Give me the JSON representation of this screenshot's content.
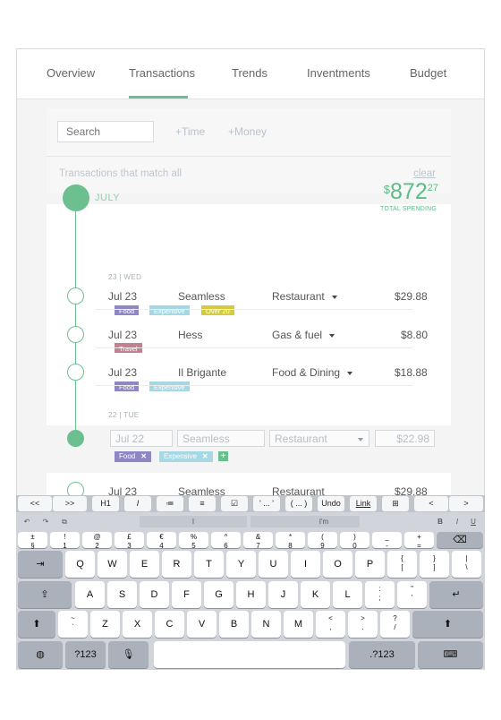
{
  "tabs": [
    "Overview",
    "Transactions",
    "Trends",
    "Inventments",
    "Budget"
  ],
  "filter": {
    "search_placeholder": "Search",
    "time_link": "+Time",
    "money_link": "+Money",
    "match_text": "Transactions that match all",
    "clear_link": "clear"
  },
  "month": {
    "label": "JULY",
    "total_currency": "$",
    "total_int": "872",
    "total_dec": "27",
    "total_label": "TOTAL SPENDING"
  },
  "days": [
    {
      "label": "23 | WED"
    },
    {
      "label": "22 | TUE"
    }
  ],
  "transactions": [
    {
      "date": "Jul 23",
      "merchant": "Seamless",
      "category": "Restaurant",
      "amount": "$29.88",
      "tags": [
        "Food",
        "Expensive",
        "Over 20"
      ]
    },
    {
      "date": "Jul 23",
      "merchant": "Hess",
      "category": "Gas & fuel",
      "amount": "$8.80",
      "tags": [
        "Travel"
      ]
    },
    {
      "date": "Jul 23",
      "merchant": "Il Brigante",
      "category": "Food & Dining",
      "amount": "$18.88",
      "tags": [
        "Food",
        "Expensive"
      ]
    }
  ],
  "editing": {
    "date": "Jul 22",
    "merchant": "Seamless",
    "category": "Restaurant",
    "amount": "$22.98",
    "tags": [
      "Food",
      "Expensive"
    ],
    "add": "+"
  },
  "partial_row": {
    "date": "Jul 23",
    "merchant": "Seamless",
    "category": "Restaurant",
    "amount": "$29.88"
  },
  "keyboard": {
    "toolbar": [
      "<<",
      ">>",
      "H1",
      "I",
      "≔",
      "≡",
      "☑",
      "' ... '",
      "( ... )",
      "Undo",
      "Link",
      "⊞",
      "<",
      ">"
    ],
    "predictive": [
      "I",
      "The",
      "I'm"
    ],
    "format": [
      "B",
      "I",
      "U"
    ],
    "edit_icons": [
      "↶",
      "↷",
      "⧉"
    ],
    "number_row": [
      [
        "±",
        "§"
      ],
      [
        "!",
        "1"
      ],
      [
        "@",
        "2"
      ],
      [
        "£",
        "3"
      ],
      [
        "€",
        "4"
      ],
      [
        "%",
        "5"
      ],
      [
        "^",
        "6"
      ],
      [
        "&",
        "7"
      ],
      [
        "*",
        "8"
      ],
      [
        "(",
        "9"
      ],
      [
        ")",
        "0"
      ],
      [
        "_",
        "-"
      ],
      [
        "+",
        "="
      ]
    ],
    "row1": [
      "Q",
      "W",
      "E",
      "R",
      "T",
      "Y",
      "U",
      "I",
      "O",
      "P"
    ],
    "row1_extra": [
      [
        "{",
        "["
      ],
      [
        "}",
        "]"
      ],
      [
        "|",
        "\\"
      ]
    ],
    "row2": [
      "A",
      "S",
      "D",
      "F",
      "G",
      "H",
      "J",
      "K",
      "L"
    ],
    "row2_extra": [
      [
        ":",
        ";"
      ],
      [
        "\"",
        "'"
      ]
    ],
    "row3": [
      "Z",
      "X",
      "C",
      "V",
      "B",
      "N",
      "M"
    ],
    "row3_extra": [
      [
        "<",
        ","
      ],
      [
        ">",
        "."
      ],
      [
        "?",
        "/"
      ]
    ],
    "numbers_label": ".?123",
    "numbers_label_left": "?123"
  }
}
